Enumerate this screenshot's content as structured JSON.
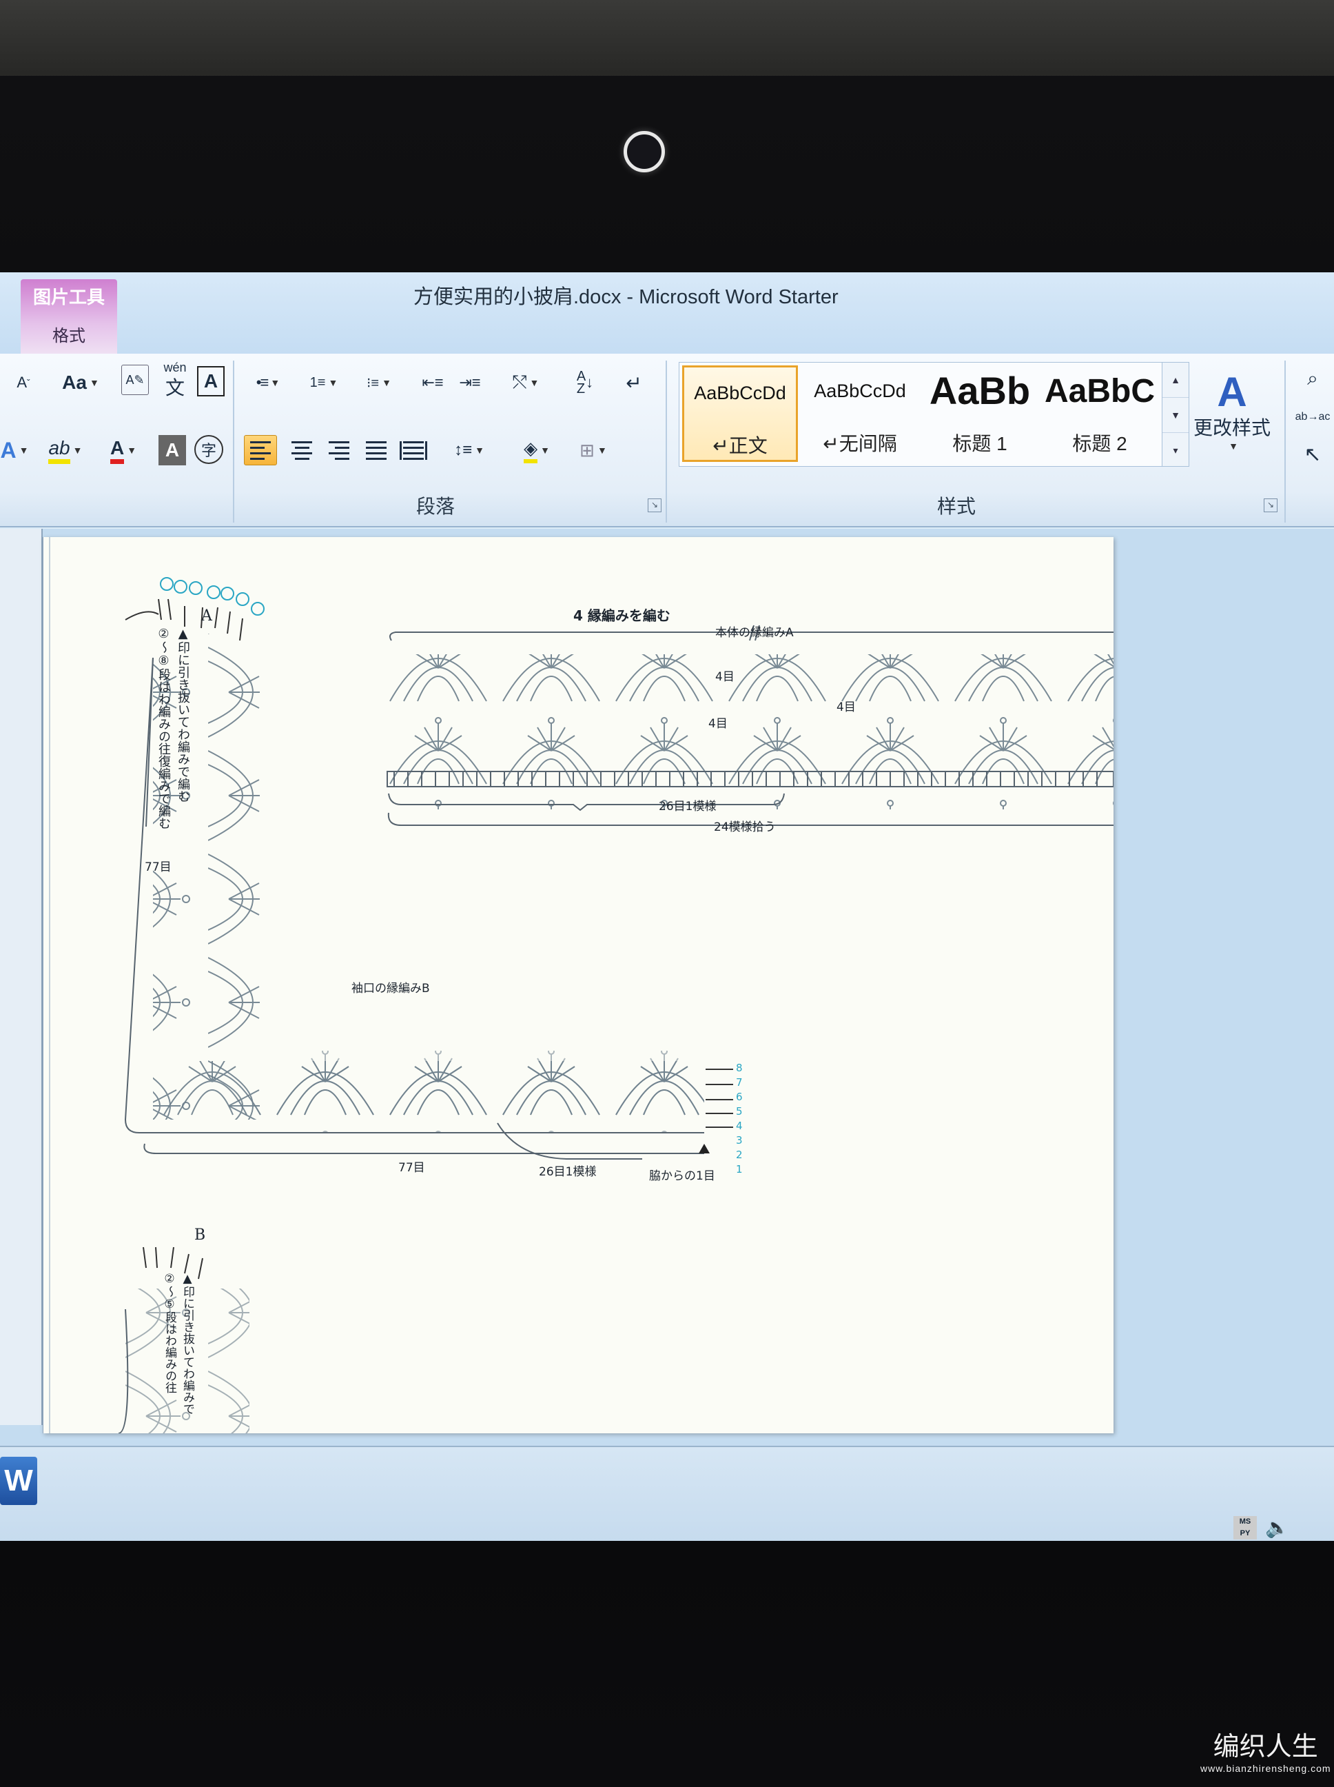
{
  "window": {
    "title": "方便实用的小披肩.docx - Microsoft Word Starter",
    "context_tab_title": "图片工具",
    "context_tab_label": "格式"
  },
  "ribbon": {
    "font_group": {
      "shrink_font": "A",
      "change_case": "Aa",
      "phonetic": "wén",
      "char_border": "A",
      "text_effect": "A",
      "highlight": "ab",
      "font_color": "A",
      "char_shading": "A",
      "enclose": "字"
    },
    "paragraph_group": {
      "label": "段落"
    },
    "styles_group": {
      "label": "样式",
      "styles": [
        {
          "sample": "AaBbCcDd",
          "name": "↵正文",
          "selected": true
        },
        {
          "sample": "AaBbCcDd",
          "name": "↵无间隔",
          "selected": false
        },
        {
          "sample": "AaBb",
          "name": "标题 1",
          "selected": false
        },
        {
          "sample": "AaBbC",
          "name": "标题 2",
          "selected": false
        }
      ],
      "change_styles": "更改样式"
    }
  },
  "document": {
    "figure": {
      "section_heading": "4 縁編みを編む",
      "label_a": "A",
      "label_b": "B",
      "border_a_title": "本体の縁編みA",
      "border_b_title": "袖口の縁編みB",
      "instruction_a": "▲印に引き抜いてわ編みで編む",
      "rows_note": "②～⑧段はわ編みの往復編みで編む",
      "instruction_b": "▲印に引き抜いてわ編みで",
      "rows_note_b": "②～⑤段はわ編みの往",
      "count_side": "77目",
      "count_bottom": "77目",
      "repeat_a": "26目1模様",
      "pickup_a": "24模様拾う",
      "repeat_b": "26目1模様",
      "start_note": "脇からの1目",
      "row_marks": [
        "4目",
        "4目",
        "4目"
      ],
      "row_numbers_b": [
        "8",
        "7",
        "6",
        "5",
        "4",
        "3",
        "2",
        "1"
      ]
    }
  },
  "taskbar": {
    "word_icon": "W",
    "tray_badge": "MS\nPY"
  },
  "watermark": {
    "title": "编织人生",
    "url": "www.bianzhirensheng.com"
  }
}
